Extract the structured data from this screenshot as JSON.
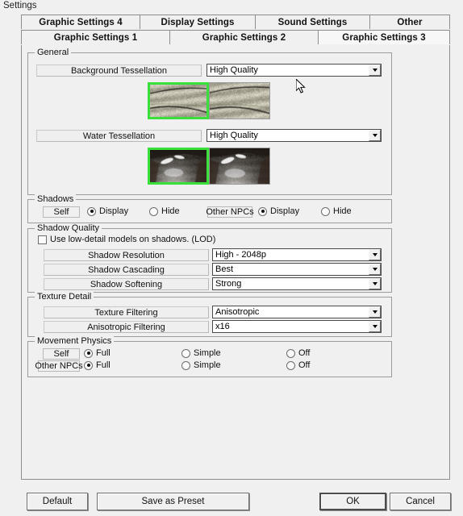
{
  "window": {
    "title": "Settings"
  },
  "tabs": {
    "row1": [
      {
        "label": "Graphic Settings 4",
        "selected": false
      },
      {
        "label": "Display Settings",
        "selected": false
      },
      {
        "label": "Sound Settings",
        "selected": false
      },
      {
        "label": "Other",
        "selected": false
      }
    ],
    "row2": [
      {
        "label": "Graphic Settings 1",
        "selected": false
      },
      {
        "label": "Graphic Settings 2",
        "selected": false
      },
      {
        "label": "Graphic Settings 3",
        "selected": true
      }
    ]
  },
  "groups": {
    "general": {
      "title": "General",
      "background_tessellation": {
        "label": "Background Tessellation",
        "value": "High Quality",
        "previews": [
          {
            "name": "background-preview-high",
            "selected": true
          },
          {
            "name": "background-preview-low",
            "selected": false
          }
        ]
      },
      "water_tessellation": {
        "label": "Water Tessellation",
        "value": "High Quality",
        "previews": [
          {
            "name": "water-preview-high",
            "selected": true
          },
          {
            "name": "water-preview-low",
            "selected": false
          }
        ]
      }
    },
    "shadows": {
      "title": "Shadows",
      "self": {
        "label": "Self",
        "options": [
          {
            "label": "Display",
            "selected": true
          },
          {
            "label": "Hide",
            "selected": false
          }
        ]
      },
      "other_npcs": {
        "label": "Other NPCs",
        "options": [
          {
            "label": "Display",
            "selected": true
          },
          {
            "label": "Hide",
            "selected": false
          }
        ]
      }
    },
    "shadow_quality": {
      "title": "Shadow Quality",
      "lod_checkbox": {
        "label": "Use low-detail models on shadows. (LOD)",
        "checked": false
      },
      "rows": [
        {
          "label": "Shadow Resolution",
          "value": "High - 2048p"
        },
        {
          "label": "Shadow Cascading",
          "value": "Best"
        },
        {
          "label": "Shadow Softening",
          "value": "Strong"
        }
      ]
    },
    "texture_detail": {
      "title": "Texture Detail",
      "rows": [
        {
          "label": "Texture Filtering",
          "value": "Anisotropic"
        },
        {
          "label": "Anisotropic Filtering",
          "value": "x16"
        }
      ]
    },
    "movement_physics": {
      "title": "Movement Physics",
      "self": {
        "label": "Self",
        "options": [
          {
            "label": "Full",
            "selected": true
          },
          {
            "label": "Simple",
            "selected": false
          },
          {
            "label": "Off",
            "selected": false
          }
        ]
      },
      "other_npcs": {
        "label": "Other NPCs",
        "options": [
          {
            "label": "Full",
            "selected": true
          },
          {
            "label": "Simple",
            "selected": false
          },
          {
            "label": "Off",
            "selected": false
          }
        ]
      }
    }
  },
  "footer": {
    "default_label": "Default",
    "save_preset_label": "Save as Preset",
    "ok_label": "OK",
    "cancel_label": "Cancel"
  },
  "colors": {
    "selection_green": "#39e03a",
    "window_bg": "#f0f0f0",
    "combo_bg": "#ffffff"
  }
}
